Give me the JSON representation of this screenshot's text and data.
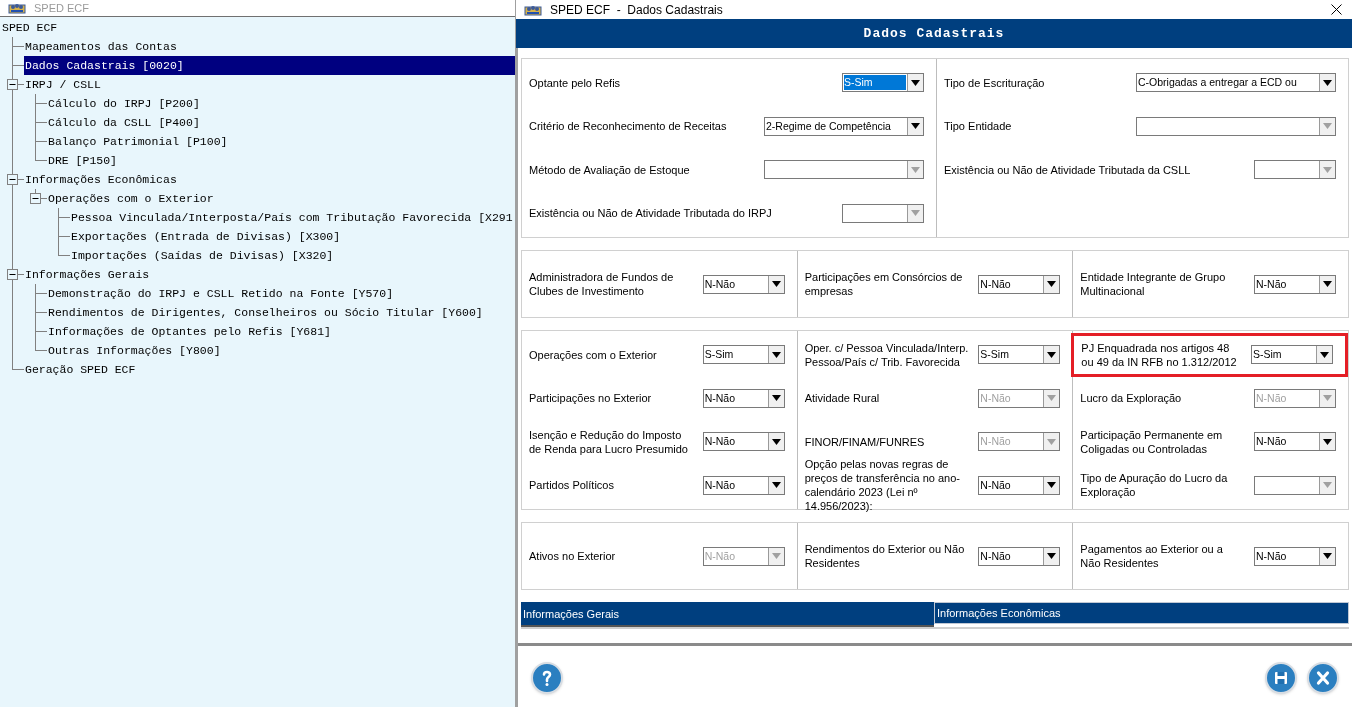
{
  "tree_window": {
    "title": "SPED ECF",
    "tree": {
      "label": "SPED ECF",
      "selected": false,
      "children": [
        {
          "label": "Mapeamentos das Contas",
          "selected": false
        },
        {
          "label": "Dados Cadastrais [0020]",
          "selected": true
        },
        {
          "label": "IRPJ / CSLL",
          "selected": false,
          "expanded": true,
          "children": [
            {
              "label": "Cálculo do IRPJ [P200]",
              "selected": false
            },
            {
              "label": "Cálculo da CSLL [P400]",
              "selected": false
            },
            {
              "label": "Balanço Patrimonial [P100]",
              "selected": false
            },
            {
              "label": "DRE [P150]",
              "selected": false
            }
          ]
        },
        {
          "label": "Informações Econômicas",
          "selected": false,
          "expanded": true,
          "children": [
            {
              "label": "Operações com o Exterior",
              "selected": false,
              "expanded": true,
              "children": [
                {
                  "label": "Pessoa Vinculada/Interposta/País com Tributação Favorecida [X291",
                  "selected": false
                },
                {
                  "label": "Exportações (Entrada de Divisas) [X300]",
                  "selected": false
                },
                {
                  "label": "Importações (Saídas de Divisas) [X320]",
                  "selected": false
                }
              ]
            }
          ]
        },
        {
          "label": "Informações Gerais",
          "selected": false,
          "expanded": true,
          "children": [
            {
              "label": "Demonstração do IRPJ e CSLL Retido na Fonte [Y570]",
              "selected": false
            },
            {
              "label": "Rendimentos de Dirigentes, Conselheiros ou Sócio Titular [Y600]",
              "selected": false
            },
            {
              "label": "Informações de Optantes pelo Refis [Y681]",
              "selected": false
            },
            {
              "label": "Outras Informações [Y800]",
              "selected": false
            }
          ]
        },
        {
          "label": "Geração SPED ECF",
          "selected": false
        }
      ]
    }
  },
  "form_window": {
    "title": "SPED ECF  -  Dados Cadastrais",
    "header": "Dados Cadastrais",
    "sections": [
      {
        "columns": [
          [
            {
              "label": "Optante pelo Refis",
              "value": "S-Sim",
              "disabled": false,
              "focused": true
            },
            {
              "label": "Critério de Reconhecimento de Receitas",
              "value": "2-Regime de Competência",
              "disabled": false
            },
            {
              "label": "Método de Avaliação de Estoque",
              "disabled": true
            },
            {
              "label": "Existência ou Não de Atividade Tributada do IRPJ",
              "disabled": true
            }
          ],
          [
            {
              "label": "Tipo de Escrituração",
              "value": "C-Obrigadas a entregar a ECD ou",
              "disabled": false
            },
            {
              "label": "Tipo Entidade",
              "disabled": true
            },
            {
              "label": "Existência ou Não de Atividade Tributada da CSLL",
              "disabled": true
            }
          ]
        ]
      },
      {
        "columns": [
          [
            {
              "label": "Administradora de Fundos de Clubes de Investimento",
              "value": "N-Não",
              "disabled": false
            }
          ],
          [
            {
              "label": "Participações em Consórcios de empresas",
              "value": "N-Não",
              "disabled": false
            }
          ],
          [
            {
              "label": "Entidade Integrante de Grupo Multinacional",
              "value": "N-Não",
              "disabled": false
            }
          ]
        ]
      },
      {
        "columns": [
          [
            {
              "label": "Operações com o Exterior",
              "value": "S-Sim",
              "disabled": false
            },
            {
              "label": "Participações no Exterior",
              "value": "N-Não",
              "disabled": false
            },
            {
              "label": "Isenção e Redução do Imposto de Renda para Lucro Presumido",
              "value": "N-Não",
              "disabled": false
            },
            {
              "label": "Partidos Políticos",
              "value": "N-Não",
              "disabled": false
            }
          ],
          [
            {
              "label": "Oper. c/ Pessoa Vinculada/Interp. Pessoa/País c/ Trib. Favorecida",
              "value": "S-Sim",
              "disabled": false
            },
            {
              "label": "Atividade Rural",
              "value": "N-Não",
              "disabled": true
            },
            {
              "label": "FINOR/FINAM/FUNRES",
              "value": "N-Não",
              "disabled": true
            },
            {
              "label": "Opção pelas novas regras de preços de transferência no ano-calendário 2023 (Lei nº 14.956/2023):",
              "value": "N-Não",
              "disabled": false
            }
          ],
          [
            {
              "label": "PJ Enquadrada nos artigos 48 ou 49 da IN RFB no 1.312/2012",
              "value": "S-Sim",
              "disabled": false,
              "highlighted": true
            },
            {
              "label": "Lucro da Exploração",
              "value": "N-Não",
              "disabled": true
            },
            {
              "label": "Participação Permanente em Coligadas ou Controladas",
              "value": "N-Não",
              "disabled": false
            },
            {
              "label": "Tipo de Apuração do Lucro da Exploração",
              "disabled": true
            }
          ]
        ]
      },
      {
        "columns": [
          [
            {
              "label": "Ativos no Exterior",
              "value": "N-Não",
              "disabled": true
            }
          ],
          [
            {
              "label": "Rendimentos do Exterior ou Não Residentes",
              "value": "N-Não",
              "disabled": false
            }
          ],
          [
            {
              "label": "Pagamentos ao Exterior ou a Não Residentes",
              "value": "N-Não",
              "disabled": false
            }
          ]
        ]
      }
    ],
    "tabs": [
      {
        "label": "Informações Gerais",
        "selected": true
      },
      {
        "label": "Informações Econômicas",
        "selected": false
      }
    ],
    "buttons": [
      {
        "kind": "help"
      },
      {
        "kind": "save"
      },
      {
        "kind": "close"
      }
    ]
  }
}
